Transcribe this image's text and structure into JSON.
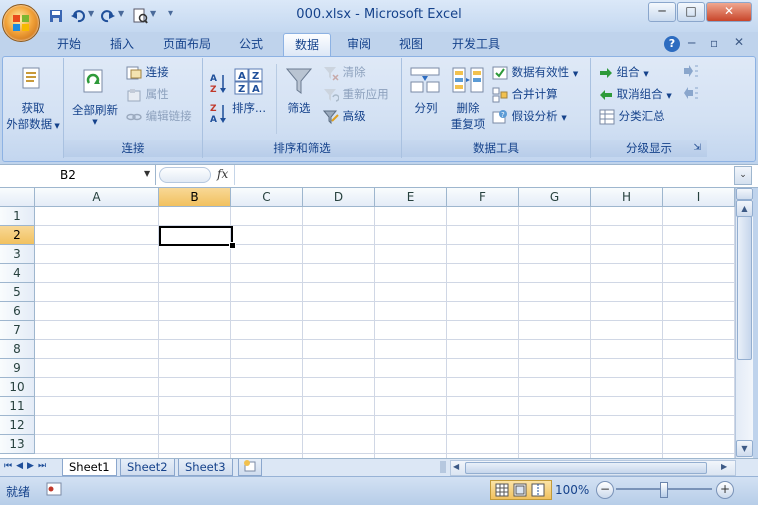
{
  "window": {
    "title": "000.xlsx - Microsoft Excel",
    "controls": [
      "─",
      "□",
      "✕"
    ],
    "ribbon_controls": [
      "?",
      "─",
      "▫",
      "✕"
    ]
  },
  "quick_access": [
    "save-icon",
    "undo-icon",
    "redo-icon",
    "print-preview-icon",
    "customize-icon"
  ],
  "tabs": [
    {
      "label": "开始"
    },
    {
      "label": "插入"
    },
    {
      "label": "页面布局"
    },
    {
      "label": "公式"
    },
    {
      "label": "数据",
      "active": true
    },
    {
      "label": "审阅"
    },
    {
      "label": "视图"
    },
    {
      "label": "开发工具"
    }
  ],
  "ribbon": {
    "get_external": {
      "line1": "获取",
      "line2": "外部数据"
    },
    "connections": {
      "refresh_all": "全部刷新",
      "connect": "连接",
      "properties": "属性",
      "edit_links": "编辑链接",
      "label": "连接"
    },
    "sort_filter": {
      "sort": "排序...",
      "filter": "筛选",
      "clear": "清除",
      "reapply": "重新应用",
      "advanced": "高级",
      "label": "排序和筛选"
    },
    "data_tools": {
      "text_to_columns": "分列",
      "remove_dup_1": "删除",
      "remove_dup_2": "重复项",
      "validation": "数据有效性",
      "consolidate": "合并计算",
      "what_if": "假设分析",
      "label": "数据工具"
    },
    "outline": {
      "group": "组合",
      "ungroup": "取消组合",
      "subtotal": "分类汇总",
      "label": "分级显示"
    }
  },
  "formula_bar": {
    "name_box": "B2",
    "fx": "fx",
    "formula": ""
  },
  "grid": {
    "columns": [
      "A",
      "B",
      "C",
      "D",
      "E",
      "F",
      "G",
      "H",
      "I"
    ],
    "rows": [
      "1",
      "2",
      "3",
      "4",
      "5",
      "6",
      "7",
      "8",
      "9",
      "10",
      "11",
      "12",
      "13"
    ],
    "selected_cell": "B2"
  },
  "sheets": [
    "Sheet1",
    "Sheet2",
    "Sheet3"
  ],
  "status": {
    "ready": "就绪",
    "zoom": "100%"
  },
  "colors": {
    "ribbon_bg": "#d3e1f3",
    "accent": "#15428b",
    "selected_header": "#f1c15f"
  }
}
